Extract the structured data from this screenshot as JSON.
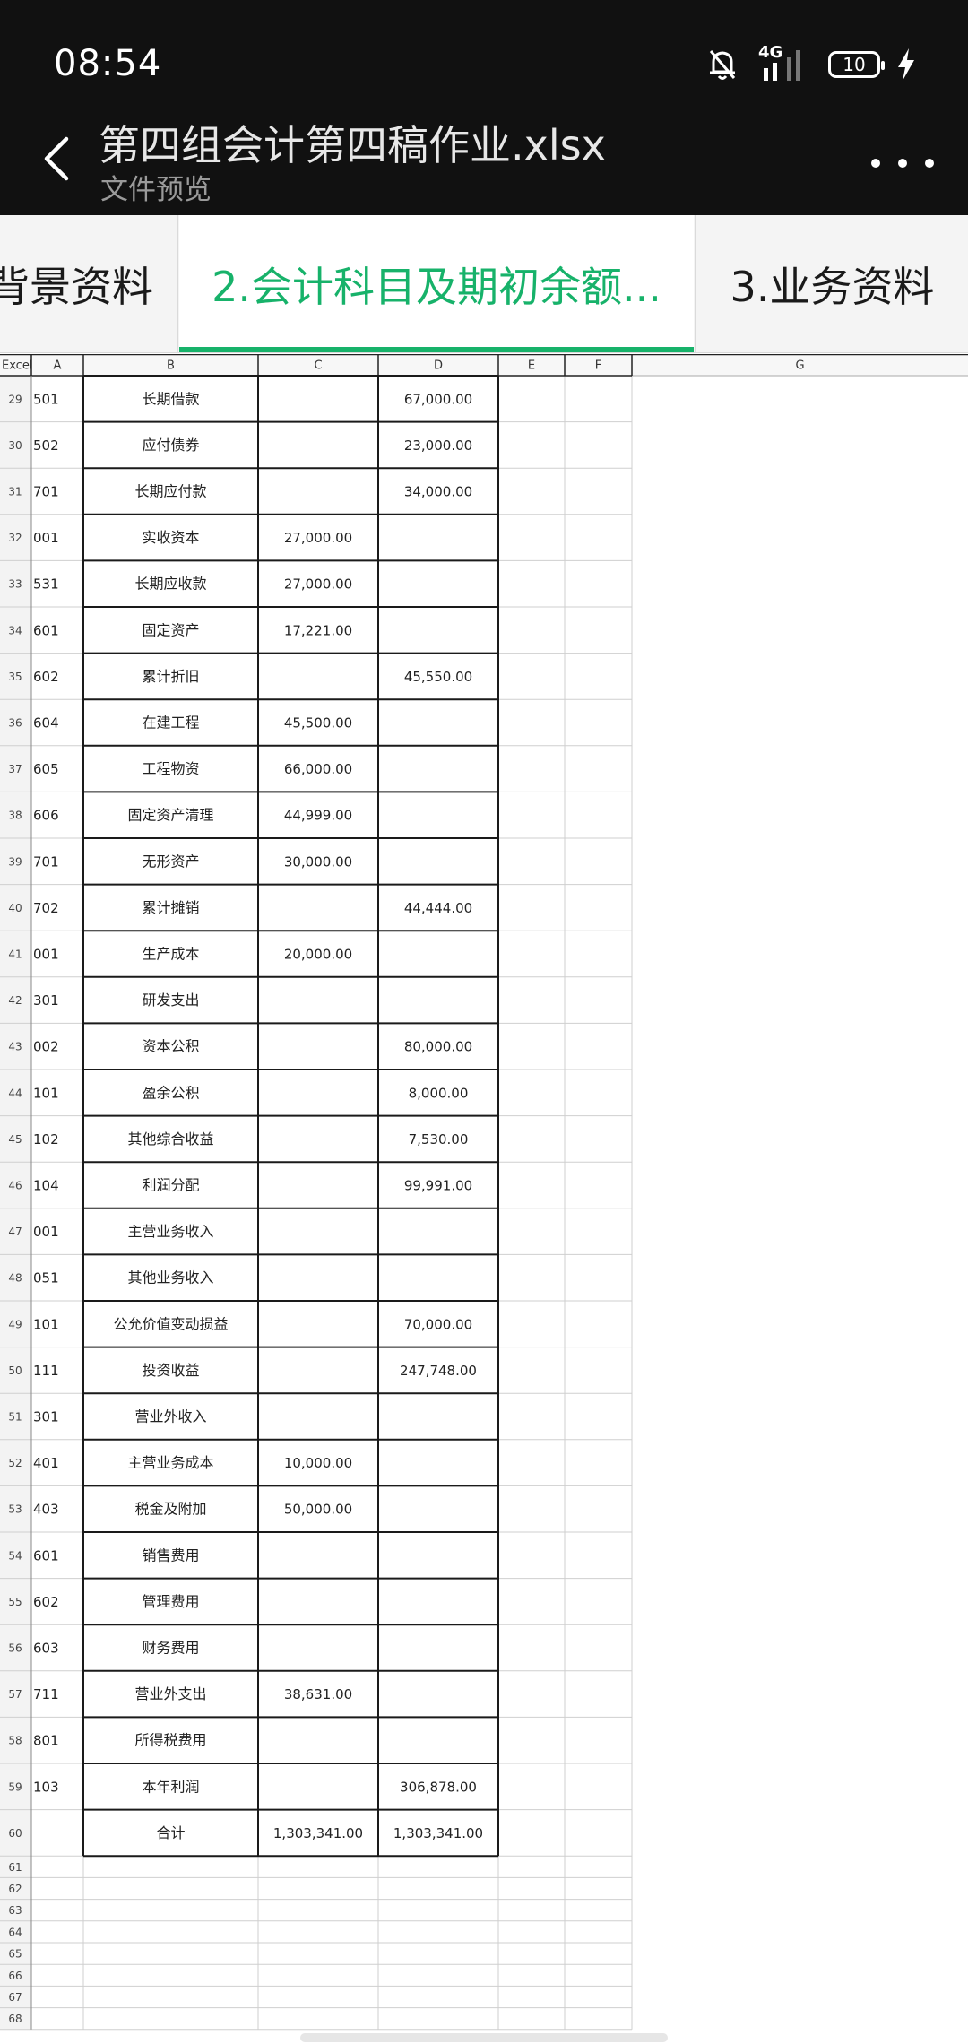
{
  "status_bar": {
    "time": "08:54",
    "network": "4G",
    "battery": "10"
  },
  "header": {
    "title": "第四组会计第四稿作业.xlsx",
    "subtitle": "文件预览"
  },
  "tabs": [
    {
      "label": "背景资料",
      "active": false
    },
    {
      "label": "2.会计科目及期初余额...",
      "active": true
    },
    {
      "label": "3.业务资料",
      "active": false
    }
  ],
  "sheet": {
    "corner": "Excel",
    "columns": [
      "A",
      "B",
      "C",
      "D",
      "E",
      "F",
      "G"
    ],
    "rows": [
      {
        "num": "29",
        "a": "501",
        "b": "长期借款",
        "c": "",
        "d": "67,000.00"
      },
      {
        "num": "30",
        "a": "502",
        "b": "应付债券",
        "c": "",
        "d": "23,000.00"
      },
      {
        "num": "31",
        "a": "701",
        "b": "长期应付款",
        "c": "",
        "d": "34,000.00"
      },
      {
        "num": "32",
        "a": "001",
        "b": "实收资本",
        "c": "27,000.00",
        "d": ""
      },
      {
        "num": "33",
        "a": "531",
        "b": "长期应收款",
        "c": "27,000.00",
        "d": ""
      },
      {
        "num": "34",
        "a": "601",
        "b": "固定资产",
        "c": "17,221.00",
        "d": ""
      },
      {
        "num": "35",
        "a": "602",
        "b": "累计折旧",
        "c": "",
        "d": "45,550.00"
      },
      {
        "num": "36",
        "a": "604",
        "b": "在建工程",
        "c": "45,500.00",
        "d": ""
      },
      {
        "num": "37",
        "a": "605",
        "b": "工程物资",
        "c": "66,000.00",
        "d": ""
      },
      {
        "num": "38",
        "a": "606",
        "b": "固定资产清理",
        "c": "44,999.00",
        "d": ""
      },
      {
        "num": "39",
        "a": "701",
        "b": "无形资产",
        "c": "30,000.00",
        "d": ""
      },
      {
        "num": "40",
        "a": "702",
        "b": "累计摊销",
        "c": "",
        "d": "44,444.00"
      },
      {
        "num": "41",
        "a": "001",
        "b": "生产成本",
        "c": "20,000.00",
        "d": ""
      },
      {
        "num": "42",
        "a": "301",
        "b": "研发支出",
        "c": "",
        "d": ""
      },
      {
        "num": "43",
        "a": "002",
        "b": "资本公积",
        "c": "",
        "d": "80,000.00"
      },
      {
        "num": "44",
        "a": "101",
        "b": "盈余公积",
        "c": "",
        "d": "8,000.00"
      },
      {
        "num": "45",
        "a": "102",
        "b": "其他综合收益",
        "c": "",
        "d": "7,530.00"
      },
      {
        "num": "46",
        "a": "104",
        "b": "利润分配",
        "c": "",
        "d": "99,991.00"
      },
      {
        "num": "47",
        "a": "001",
        "b": "主营业务收入",
        "c": "",
        "d": ""
      },
      {
        "num": "48",
        "a": "051",
        "b": "其他业务收入",
        "c": "",
        "d": ""
      },
      {
        "num": "49",
        "a": "101",
        "b": "公允价值变动损益",
        "c": "",
        "d": "70,000.00"
      },
      {
        "num": "50",
        "a": "111",
        "b": "投资收益",
        "c": "",
        "d": "247,748.00"
      },
      {
        "num": "51",
        "a": "301",
        "b": "营业外收入",
        "c": "",
        "d": ""
      },
      {
        "num": "52",
        "a": "401",
        "b": "主营业务成本",
        "c": "10,000.00",
        "d": ""
      },
      {
        "num": "53",
        "a": "403",
        "b": "税金及附加",
        "c": "50,000.00",
        "d": ""
      },
      {
        "num": "54",
        "a": "601",
        "b": "销售费用",
        "c": "",
        "d": ""
      },
      {
        "num": "55",
        "a": "602",
        "b": "管理费用",
        "c": "",
        "d": ""
      },
      {
        "num": "56",
        "a": "603",
        "b": "财务费用",
        "c": "",
        "d": ""
      },
      {
        "num": "57",
        "a": "711",
        "b": "营业外支出",
        "c": "38,631.00",
        "d": ""
      },
      {
        "num": "58",
        "a": "801",
        "b": "所得税费用",
        "c": "",
        "d": ""
      },
      {
        "num": "59",
        "a": "103",
        "b": "本年利润",
        "c": "",
        "d": "306,878.00"
      },
      {
        "num": "60",
        "a": "",
        "b": "合计",
        "c": "1,303,341.00",
        "d": "1,303,341.00"
      }
    ],
    "empty_rows": [
      "61",
      "62",
      "63",
      "64",
      "65",
      "66",
      "67",
      "68"
    ]
  },
  "colors": {
    "accent": "#17b26a",
    "bar": "#111111",
    "tab_bg": "#f4f4f4"
  }
}
